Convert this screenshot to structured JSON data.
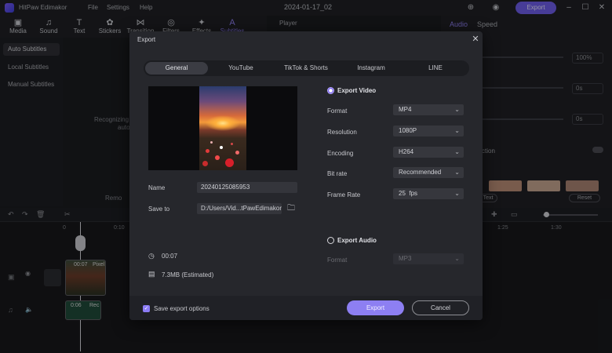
{
  "app": {
    "name": "HitPaw Edimakor",
    "menu": [
      "File",
      "Settings",
      "Help"
    ],
    "doc_title": "2024-01-17_02",
    "export_label": "Export"
  },
  "toolbar": [
    "Media",
    "Sound",
    "Text",
    "Stickers",
    "Transition",
    "Filters",
    "Effects",
    "Subtitles"
  ],
  "sidebar": [
    "Auto Subtitles",
    "Local Subtitles",
    "Manual Subtitles"
  ],
  "background": {
    "recognizing": "Recognizing",
    "auto": "auto",
    "remove": "Remo",
    "player": "Player",
    "right_tabs": [
      "Audio",
      "Speed"
    ],
    "percent": "100%",
    "zero1": "0s",
    "zero2": "0s",
    "ction": "ction",
    "text_btn": "Text",
    "reset_btn": "Reset",
    "ruler": [
      "0",
      "0:10",
      "1:25",
      "1:30"
    ],
    "clip1_time": "00:07",
    "clip1_name": "Pixel",
    "clip2_time": "0:06",
    "clip2_name": "Rec"
  },
  "dialog": {
    "title": "Export",
    "tabs": [
      "General",
      "YouTube",
      "TikTok & Shorts",
      "Instagram",
      "LINE"
    ],
    "name_label": "Name",
    "name_value": "20240125085953",
    "saveto_label": "Save to",
    "saveto_value": "D:/Users/Vid...tPawEdimakor",
    "duration": "00:07",
    "size": "7.3MB (Estimated)",
    "export_video": "Export Video",
    "video_rows": [
      {
        "label": "Format",
        "value": "MP4"
      },
      {
        "label": "Resolution",
        "value": "1080P"
      },
      {
        "label": "Encoding",
        "value": "H264"
      },
      {
        "label": "Bit rate",
        "value": "Recommended"
      },
      {
        "label": "Frame Rate",
        "value": "25  fps"
      }
    ],
    "export_audio": "Export Audio",
    "audio_format_label": "Format",
    "audio_format_value": "MP3",
    "save_options": "Save export options",
    "export_btn": "Export",
    "cancel_btn": "Cancel"
  }
}
